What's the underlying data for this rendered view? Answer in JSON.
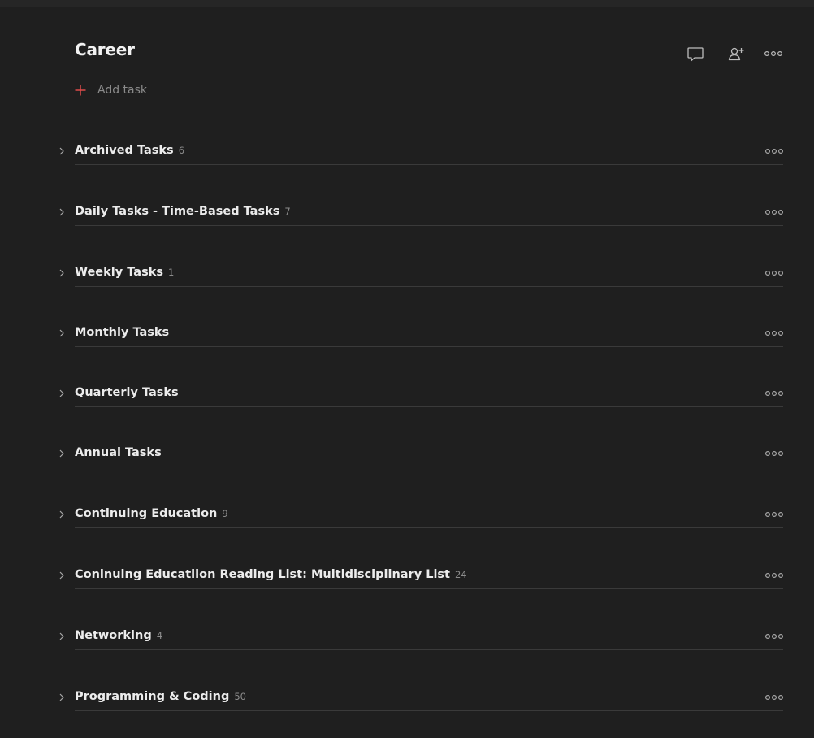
{
  "project": {
    "title": "Career"
  },
  "header_actions": [
    {
      "icon": "comment-icon"
    },
    {
      "icon": "share-person-icon"
    },
    {
      "icon": "more-icon"
    }
  ],
  "add_task": {
    "label": "Add task",
    "icon": "plus-icon",
    "accent": "#de4c4a"
  },
  "sections": [
    {
      "name": "Archived Tasks",
      "count": "6"
    },
    {
      "name": "Daily Tasks - Time-Based Tasks",
      "count": "7"
    },
    {
      "name": "Weekly Tasks",
      "count": "1"
    },
    {
      "name": "Monthly Tasks",
      "count": ""
    },
    {
      "name": "Quarterly Tasks",
      "count": ""
    },
    {
      "name": "Annual Tasks",
      "count": ""
    },
    {
      "name": "Continuing Education",
      "count": "9"
    },
    {
      "name": "Coninuing Educatiion Reading List: Multidisciplinary List",
      "count": "24"
    },
    {
      "name": "Networking",
      "count": "4"
    },
    {
      "name": "Programming & Coding",
      "count": "50"
    }
  ],
  "colors": {
    "background": "#1f1f1f",
    "text": "#ececec",
    "muted": "#8c8c8c",
    "divider": "#3a3a3a"
  }
}
